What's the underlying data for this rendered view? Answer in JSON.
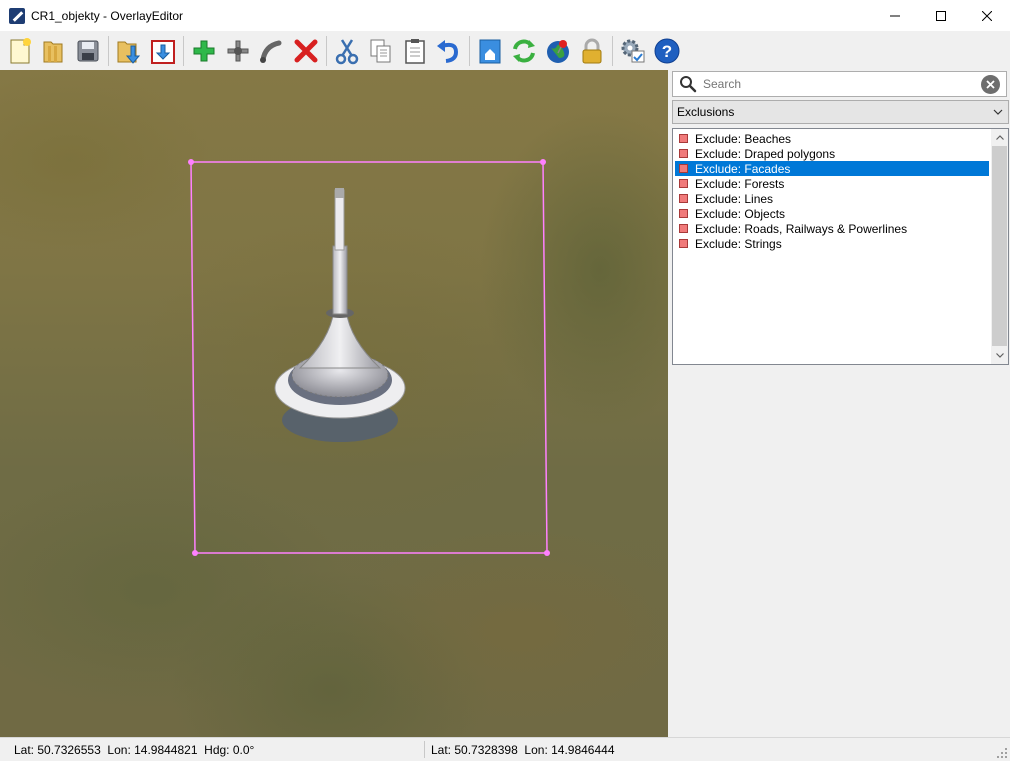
{
  "window": {
    "title": "CR1_objekty - OverlayEditor"
  },
  "toolbar": {
    "buttons": [
      {
        "name": "new-icon"
      },
      {
        "name": "open-icon"
      },
      {
        "name": "save-icon"
      },
      {
        "name": "import-icon"
      },
      {
        "name": "export-icon"
      },
      {
        "name": "add-icon"
      },
      {
        "name": "add-node-icon"
      },
      {
        "name": "bezier-icon"
      },
      {
        "name": "delete-icon"
      },
      {
        "name": "cut-icon"
      },
      {
        "name": "copy-icon"
      },
      {
        "name": "paste-icon"
      },
      {
        "name": "undo-icon"
      },
      {
        "name": "home-icon"
      },
      {
        "name": "reload-icon"
      },
      {
        "name": "goto-globe-icon"
      },
      {
        "name": "lock-icon"
      },
      {
        "name": "preferences-icon"
      },
      {
        "name": "help-icon"
      }
    ]
  },
  "panel": {
    "search_placeholder": "Search",
    "category": "Exclusions",
    "items": [
      {
        "label": "Exclude: Beaches",
        "selected": false
      },
      {
        "label": "Exclude: Draped polygons",
        "selected": false
      },
      {
        "label": "Exclude: Facades",
        "selected": true
      },
      {
        "label": "Exclude: Forests",
        "selected": false
      },
      {
        "label": "Exclude: Lines",
        "selected": false
      },
      {
        "label": "Exclude: Objects",
        "selected": false
      },
      {
        "label": "Exclude: Roads, Railways & Powerlines",
        "selected": false
      },
      {
        "label": "Exclude: Strings",
        "selected": false
      }
    ],
    "swatch_color": "#f07a7a",
    "selection_color": "#0078d7"
  },
  "status": {
    "left": "Lat: 50.7326553  Lon: 14.9844821  Hdg: 0.0°",
    "right": "Lat: 50.7328398  Lon: 14.9846444"
  },
  "map": {
    "exclusion_outline_color": "#ff80ff"
  }
}
